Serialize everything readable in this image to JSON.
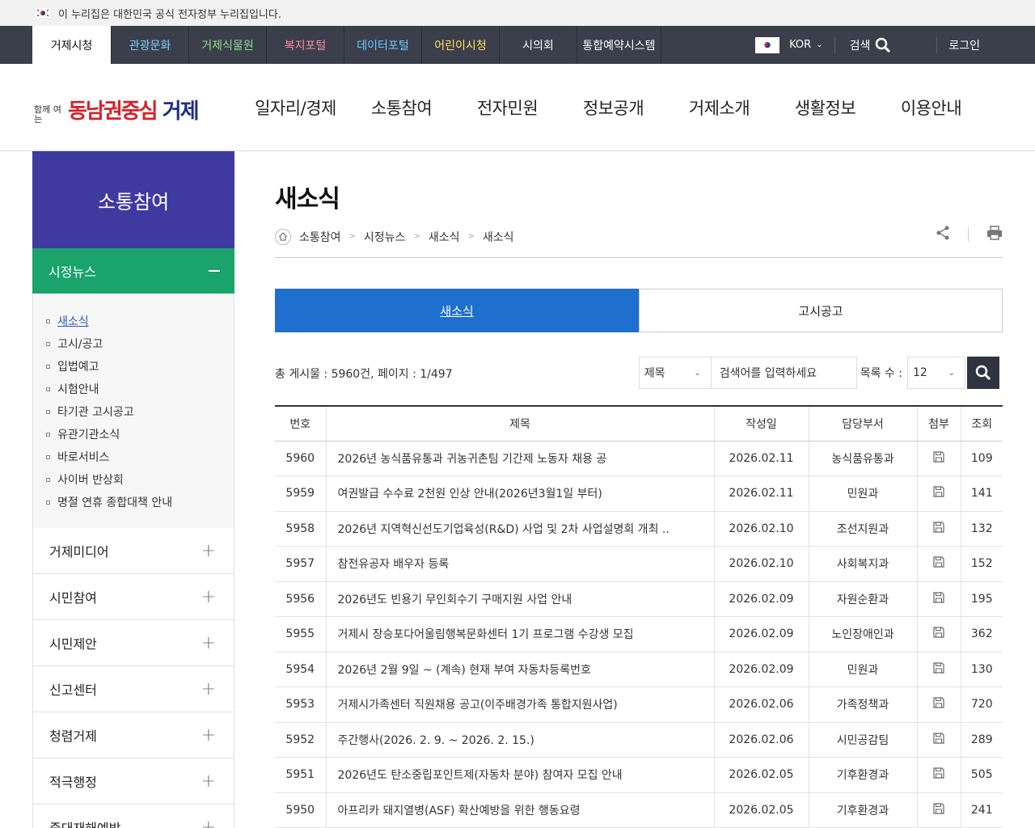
{
  "gov_banner": "이 누리집은 대한민국 공식 전자정부 누리집입니다.",
  "topbar": {
    "tabs": [
      {
        "label": "거제시청",
        "color": "#111111"
      },
      {
        "label": "관광문화",
        "color": "#7fd3ff"
      },
      {
        "label": "거제식물원",
        "color": "#8fe08f"
      },
      {
        "label": "복지포털",
        "color": "#ff8fa8"
      },
      {
        "label": "데이터포털",
        "color": "#6fc6ff"
      },
      {
        "label": "어린이시청",
        "color": "#ffe55c"
      },
      {
        "label": "시의회",
        "color": "#ffffff"
      },
      {
        "label": "통합예약시스템",
        "color": "#ffffff"
      }
    ],
    "lang": "KOR",
    "search": "검색",
    "login": "로그인"
  },
  "logo": {
    "small": "함께 여는",
    "main_red": "동남권중심",
    "main_blue": "거제"
  },
  "mainnav": [
    "일자리/경제",
    "소통참여",
    "전자민원",
    "정보공개",
    "거제소개",
    "생활정보",
    "이용안내"
  ],
  "sidebar": {
    "title": "소통참여",
    "section": "시정뉴스",
    "section_icon": "minus-icon",
    "sub_items": [
      "새소식",
      "고시/공고",
      "입법예고",
      "시험안내",
      "타기관 고시공고",
      "유관기관소식",
      "바로서비스",
      "사이버 반상회",
      "명절 연휴 종합대책 안내"
    ],
    "menus": [
      "거제미디어",
      "시민참여",
      "시민제안",
      "신고센터",
      "청렴거제",
      "적극행정",
      "중대재해예방"
    ]
  },
  "content": {
    "title": "새소식",
    "breadcrumb": [
      "소통참여",
      "시정뉴스",
      "새소식",
      "새소식"
    ],
    "tabs": [
      "새소식",
      "고시공고"
    ],
    "total": "총 게시물 : 5960건, 페이지 : 1/497",
    "search_field": "제목",
    "search_placeholder": "검색어를 입력하세요",
    "count_label": "목록 수 :",
    "count_value": "12"
  },
  "table": {
    "headers": [
      "번호",
      "제목",
      "작성일",
      "담당부서",
      "첨부",
      "조회"
    ],
    "rows": [
      {
        "no": "5960",
        "title": "2026년 농식품유통과 귀농귀촌팀 기간제 노동자 채용 공",
        "date": "2026.02.11",
        "dept": "농식품유통과",
        "views": "109"
      },
      {
        "no": "5959",
        "title": "여권발급 수수료 2천원 인상 안내(2026년3월1일 부터)",
        "date": "2026.02.11",
        "dept": "민원과",
        "views": "141"
      },
      {
        "no": "5958",
        "title": "2026년 지역혁신선도기업육성(R&D) 사업 및 2차 사업설명회 개최 ..",
        "date": "2026.02.10",
        "dept": "조선지원과",
        "views": "132"
      },
      {
        "no": "5957",
        "title": "참전유공자 배우자 등록",
        "date": "2026.02.10",
        "dept": "사회복지과",
        "views": "152"
      },
      {
        "no": "5956",
        "title": "2026년도 빈용기 무인회수기 구매지원 사업 안내",
        "date": "2026.02.09",
        "dept": "자원순환과",
        "views": "195"
      },
      {
        "no": "5955",
        "title": "거제시 장승포다어울림행복문화센터 1기 프로그램 수강생 모집",
        "date": "2026.02.09",
        "dept": "노인장애인과",
        "views": "362"
      },
      {
        "no": "5954",
        "title": "2026년 2월 9일 ~ (계속) 현재 부여 자동차등록번호",
        "date": "2026.02.09",
        "dept": "민원과",
        "views": "130"
      },
      {
        "no": "5953",
        "title": "거제시가족센터 직원채용 공고(이주배경가족 통합지원사업)",
        "date": "2026.02.06",
        "dept": "가족정책과",
        "views": "720"
      },
      {
        "no": "5952",
        "title": "주간행사(2026. 2. 9. ~ 2026. 2. 15.)",
        "date": "2026.02.06",
        "dept": "시민공감팀",
        "views": "289"
      },
      {
        "no": "5951",
        "title": "2026년도 탄소중립포인트제(자동차 분야) 참여자 모집 안내",
        "date": "2026.02.05",
        "dept": "기후환경과",
        "views": "505"
      },
      {
        "no": "5950",
        "title": "아프리카 돼지열병(ASF) 확산예방을 위한 행동요령",
        "date": "2026.02.05",
        "dept": "기후환경과",
        "views": "241"
      }
    ]
  }
}
